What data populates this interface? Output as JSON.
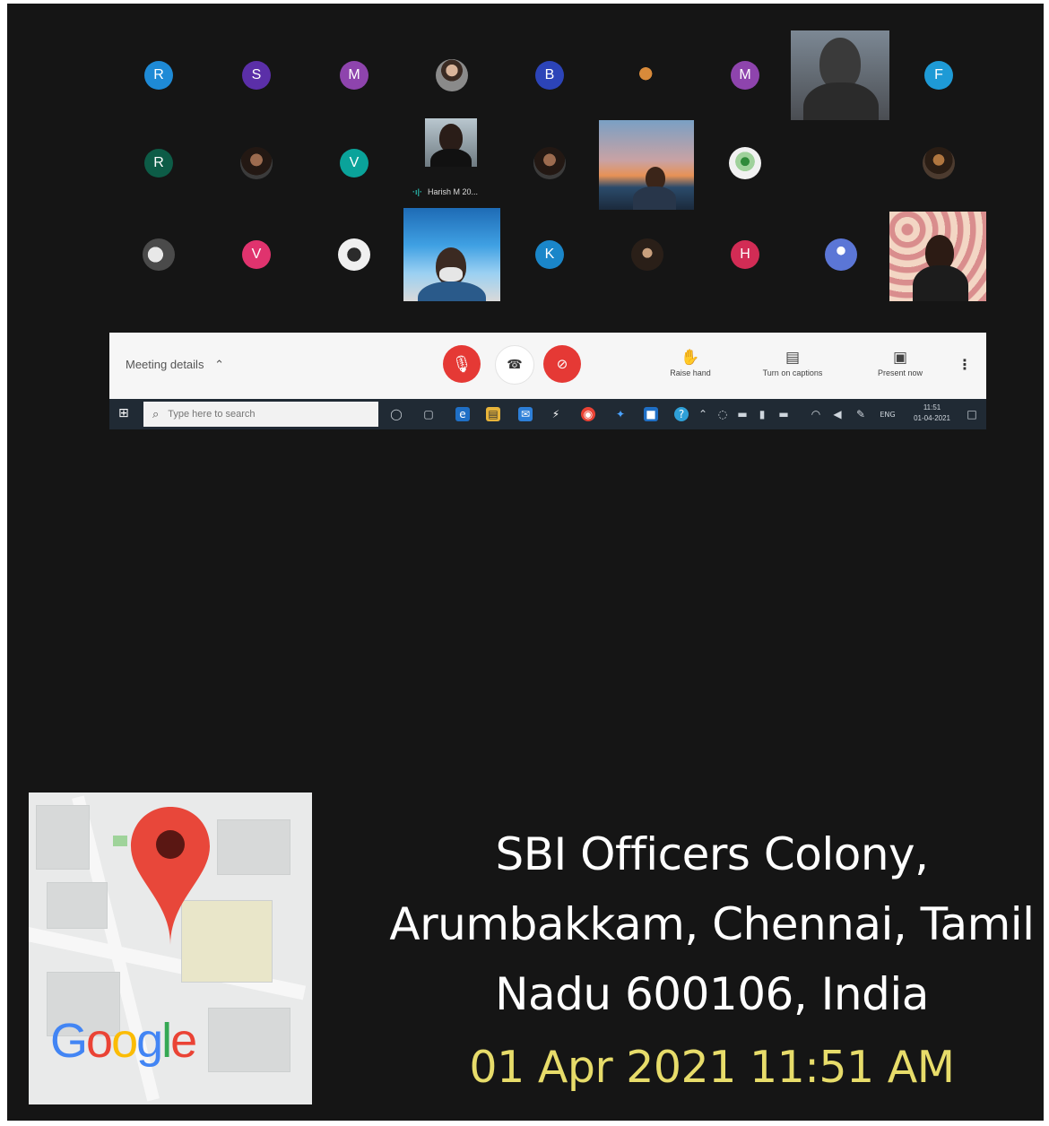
{
  "participants": [
    {
      "initial": "R",
      "color": "#1e8ad6"
    },
    {
      "initial": "S",
      "color": "#5b2fa8"
    },
    {
      "initial": "M",
      "color": "#8e44ad"
    },
    {
      "initial": "B",
      "color": "#2c44b8"
    },
    {
      "initial": "M",
      "color": "#8e44ad"
    },
    {
      "initial": "F",
      "color": "#1e9ad6"
    },
    {
      "initial": "R",
      "color": "#0d5c47"
    },
    {
      "initial": "V",
      "color": "#0aa39a"
    },
    {
      "initial": "V",
      "color": "#e0336e"
    },
    {
      "initial": "K",
      "color": "#1a86c9"
    },
    {
      "initial": "H",
      "color": "#d22c55"
    }
  ],
  "speaker_tag": "Harish M 20...",
  "controls": {
    "meeting_details": "Meeting details",
    "raise_hand": "Raise hand",
    "captions": "Turn on captions",
    "present": "Present now",
    "colors": {
      "end": "#e53935",
      "bar": "#f6f6f6"
    }
  },
  "taskbar": {
    "search_placeholder": "Type here to search",
    "lang": "ENG",
    "clock_time": "11:51",
    "clock_date": "01-04-2021"
  },
  "map": {
    "brand": [
      "G",
      "o",
      "o",
      "g",
      "l",
      "e"
    ],
    "brand_colors": [
      "#4285F4",
      "#EA4335",
      "#FBBC05",
      "#4285F4",
      "#34A853",
      "#EA4335"
    ]
  },
  "location": {
    "line1": "SBI Officers Colony,",
    "line2": "Arumbakkam, Chennai, Tamil",
    "line3": "Nadu 600106, India",
    "timestamp": "01 Apr 2021 11:51 AM",
    "timestamp_color": "#e7dc6a"
  }
}
